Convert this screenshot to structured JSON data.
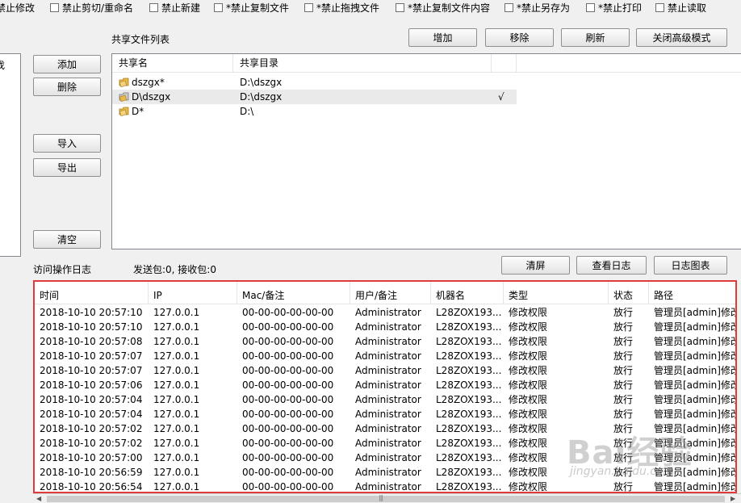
{
  "toolbar_checks": [
    {
      "label": "禁止修改"
    },
    {
      "label": "禁止剪切/重命名"
    },
    {
      "label": "禁止新建"
    },
    {
      "label": "*禁止复制文件"
    },
    {
      "label": "*禁止拖拽文件"
    },
    {
      "label": "*禁止复制文件内容"
    },
    {
      "label": "*禁止另存为"
    },
    {
      "label": "*禁止打印"
    },
    {
      "label": "禁止读取"
    }
  ],
  "left_panel": {
    "fragment": "找"
  },
  "left_buttons": {
    "add": "添加",
    "delete": "删除",
    "import": "导入",
    "export": "导出",
    "clear": "清空"
  },
  "share": {
    "title": "共享文件列表",
    "buttons": {
      "add": "增加",
      "remove": "移除",
      "refresh": "刷新",
      "close_advanced": "关闭高级模式"
    },
    "columns": [
      "共享名",
      "共享目录"
    ],
    "rows": [
      {
        "name": "dszgx*",
        "dir": "D:\\dszgx",
        "mark": ""
      },
      {
        "name": "D\\dszgx",
        "dir": "D:\\dszgx",
        "mark": "√"
      },
      {
        "name": "D*",
        "dir": "D:\\",
        "mark": ""
      }
    ]
  },
  "log": {
    "title": "访问操作日志",
    "stats": "发送包:0, 接收包:0",
    "buttons": {
      "clear_screen": "清屏",
      "view_log": "查看日志",
      "log_chart": "日志图表"
    },
    "columns": [
      "时间",
      "IP",
      "Mac/备注",
      "用户/备注",
      "机器名",
      "类型",
      "状态",
      "路径"
    ],
    "rows": [
      [
        "2018-10-10 20:57:10",
        "127.0.0.1",
        "00-00-00-00-00-00",
        "Administrator",
        "L28ZOX193...",
        "修改权限",
        "放行",
        "管理员[admin]修改共"
      ],
      [
        "2018-10-10 20:57:10",
        "127.0.0.1",
        "00-00-00-00-00-00",
        "Administrator",
        "L28ZOX193...",
        "修改权限",
        "放行",
        "管理员[admin]修改共"
      ],
      [
        "2018-10-10 20:57:08",
        "127.0.0.1",
        "00-00-00-00-00-00",
        "Administrator",
        "L28ZOX193...",
        "修改权限",
        "放行",
        "管理员[admin]修改共"
      ],
      [
        "2018-10-10 20:57:07",
        "127.0.0.1",
        "00-00-00-00-00-00",
        "Administrator",
        "L28ZOX193...",
        "修改权限",
        "放行",
        "管理员[admin]修改共"
      ],
      [
        "2018-10-10 20:57:07",
        "127.0.0.1",
        "00-00-00-00-00-00",
        "Administrator",
        "L28ZOX193...",
        "修改权限",
        "放行",
        "管理员[admin]修改共"
      ],
      [
        "2018-10-10 20:57:06",
        "127.0.0.1",
        "00-00-00-00-00-00",
        "Administrator",
        "L28ZOX193...",
        "修改权限",
        "放行",
        "管理员[admin]修改共"
      ],
      [
        "2018-10-10 20:57:04",
        "127.0.0.1",
        "00-00-00-00-00-00",
        "Administrator",
        "L28ZOX193...",
        "修改权限",
        "放行",
        "管理员[admin]修改共"
      ],
      [
        "2018-10-10 20:57:04",
        "127.0.0.1",
        "00-00-00-00-00-00",
        "Administrator",
        "L28ZOX193...",
        "修改权限",
        "放行",
        "管理员[admin]修改共"
      ],
      [
        "2018-10-10 20:57:02",
        "127.0.0.1",
        "00-00-00-00-00-00",
        "Administrator",
        "L28ZOX193...",
        "修改权限",
        "放行",
        "管理员[admin]修改共"
      ],
      [
        "2018-10-10 20:57:02",
        "127.0.0.1",
        "00-00-00-00-00-00",
        "Administrator",
        "L28ZOX193...",
        "修改权限",
        "放行",
        "管理员[admin]修改共"
      ],
      [
        "2018-10-10 20:57:00",
        "127.0.0.1",
        "00-00-00-00-00-00",
        "Administrator",
        "L28ZOX193...",
        "修改权限",
        "放行",
        "管理员[admin]修改共"
      ],
      [
        "2018-10-10 20:56:59",
        "127.0.0.1",
        "00-00-00-00-00-00",
        "Administrator",
        "L28ZOX193...",
        "修改权限",
        "放行",
        "管理员[admin]修改共"
      ],
      [
        "2018-10-10 20:56:54",
        "127.0.0.1",
        "00-00-00-00-00-00",
        "Administrator",
        "L28ZOX193...",
        "修改权限",
        "放行",
        "管理员[admin]修改共"
      ]
    ]
  },
  "watermark": {
    "brand": "Bai经验",
    "sub": "jingyan.baidu.com"
  },
  "colors": {
    "highlight_border": "#e03a3a",
    "selected_row": "#eaeaea",
    "folder": "#e8b84a"
  }
}
